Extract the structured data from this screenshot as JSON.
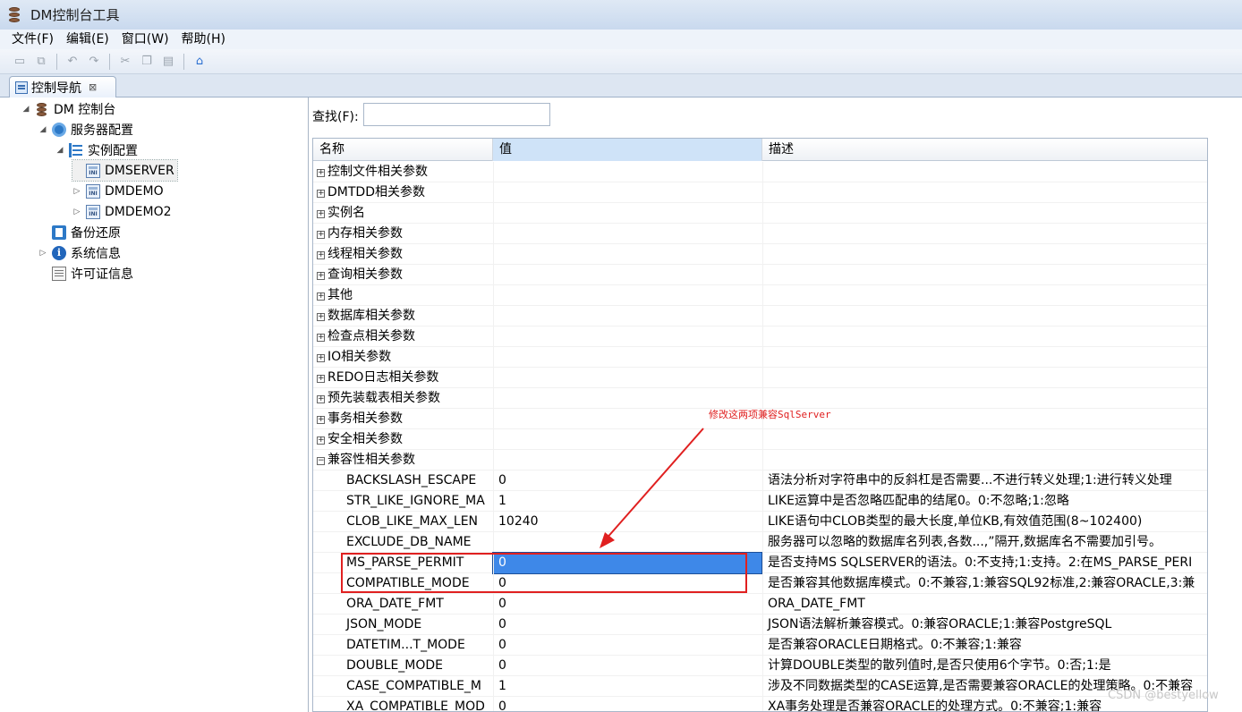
{
  "window": {
    "title": "DM控制台工具"
  },
  "menu": [
    "文件(F)",
    "编辑(E)",
    "窗口(W)",
    "帮助(H)"
  ],
  "toolbar": {
    "icons": [
      "save-icon",
      "save-all-icon",
      "undo-icon",
      "redo-icon",
      "cut-icon",
      "copy-icon",
      "paste-icon",
      "home-icon"
    ]
  },
  "tab": {
    "label": "控制导航",
    "close": "⊠"
  },
  "tree": {
    "root": "DM 控制台",
    "server_config": "服务器配置",
    "instance_config": "实例配置",
    "instances": [
      "DMSERVER",
      "DMDEMO",
      "DMDEMO2"
    ],
    "backup": "备份还原",
    "system_info": "系统信息",
    "license_info": "许可证信息"
  },
  "search": {
    "label": "查找(F):",
    "value": ""
  },
  "grid": {
    "headers": [
      "名称",
      "值",
      "描述"
    ],
    "groups": [
      "控制文件相关参数",
      "DMTDD相关参数",
      "实例名",
      "内存相关参数",
      "线程相关参数",
      "查询相关参数",
      "其他",
      "数据库相关参数",
      "检查点相关参数",
      "IO相关参数",
      "REDO日志相关参数",
      "预先装载表相关参数",
      "事务相关参数",
      "安全相关参数",
      "兼容性相关参数"
    ],
    "params": [
      {
        "name": "BACKSLASH_ESCAPE",
        "value": "0",
        "desc": "语法分析对字符串中的反斜杠是否需要...不进行转义处理;1:进行转义处理"
      },
      {
        "name": "STR_LIKE_IGNORE_MA",
        "value": "1",
        "desc": "LIKE运算中是否忽略匹配串的结尾0。0:不忽略;1:忽略"
      },
      {
        "name": "CLOB_LIKE_MAX_LEN",
        "value": "10240",
        "desc": "LIKE语句中CLOB类型的最大长度,单位KB,有效值范围(8~102400)"
      },
      {
        "name": "EXCLUDE_DB_NAME",
        "value": "",
        "desc": "服务器可以忽略的数据库名列表,各数...,”隔开,数据库名不需要加引号。"
      },
      {
        "name": "MS_PARSE_PERMIT",
        "value": "0",
        "desc": "是否支持MS SQLSERVER的语法。0:不支持;1:支持。2:在MS_PARSE_PERI"
      },
      {
        "name": "COMPATIBLE_MODE",
        "value": "0",
        "desc": "是否兼容其他数据库模式。0:不兼容,1:兼容SQL92标准,2:兼容ORACLE,3:兼"
      },
      {
        "name": "ORA_DATE_FMT",
        "value": "0",
        "desc": "ORA_DATE_FMT"
      },
      {
        "name": "JSON_MODE",
        "value": "0",
        "desc": "JSON语法解析兼容模式。0:兼容ORACLE;1:兼容PostgreSQL"
      },
      {
        "name": "DATETIM...T_MODE",
        "value": "0",
        "desc": "是否兼容ORACLE日期格式。0:不兼容;1:兼容"
      },
      {
        "name": "DOUBLE_MODE",
        "value": "0",
        "desc": "计算DOUBLE类型的散列值时,是否只使用6个字节。0:否;1:是"
      },
      {
        "name": "CASE_COMPATIBLE_M",
        "value": "1",
        "desc": "涉及不同数据类型的CASE运算,是否需要兼容ORACLE的处理策略。0:不兼容"
      },
      {
        "name": "XA_COMPATIBLE_MOD",
        "value": "0",
        "desc": "XA事务处理是否兼容ORACLE的处理方式。0:不兼容;1:兼容"
      }
    ]
  },
  "annotation": {
    "text": "修改这两项兼容SqlServer",
    "color": "#e02020"
  },
  "watermark": "CSDN @bestyellow"
}
